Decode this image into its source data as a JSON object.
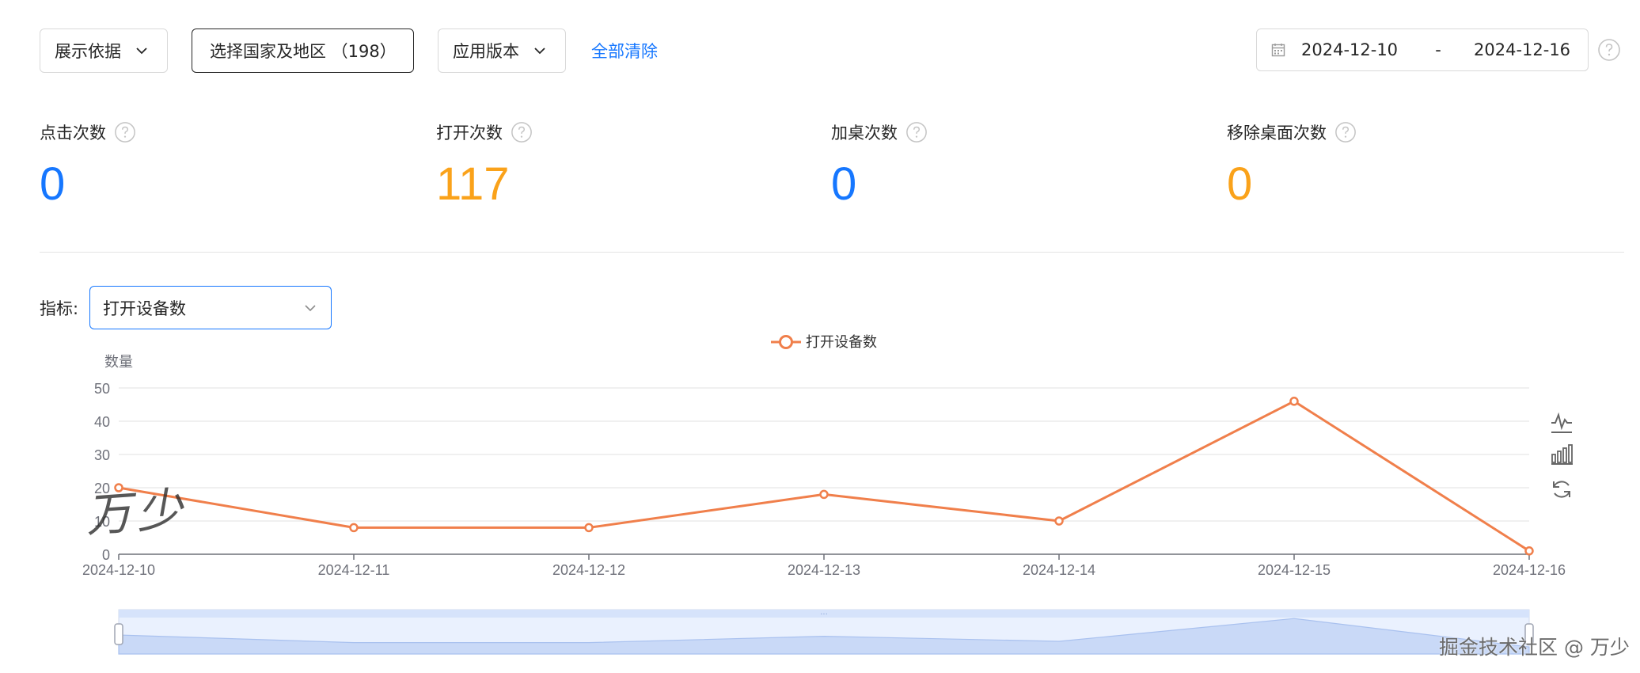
{
  "filters": {
    "basis_label": "展示依据",
    "country_label": "选择国家及地区 （198）",
    "version_label": "应用版本",
    "clear_label": "全部清除"
  },
  "date_range": {
    "start": "2024-12-10",
    "separator": "-",
    "end": "2024-12-16"
  },
  "metrics": [
    {
      "label": "点击次数",
      "value": "0",
      "color": "#1677ff"
    },
    {
      "label": "打开次数",
      "value": "117",
      "color": "#faa21a"
    },
    {
      "label": "加桌次数",
      "value": "0",
      "color": "#1677ff"
    },
    {
      "label": "移除桌面次数",
      "value": "0",
      "color": "#faa21a"
    }
  ],
  "indicator": {
    "label": "指标:",
    "selected": "打开设备数"
  },
  "colors": {
    "accent": "#1677ff",
    "series": "#f07f4b",
    "orange": "#faa21a"
  },
  "toolbox_icons": [
    "line-chart-icon",
    "bar-chart-icon",
    "restore-icon"
  ],
  "chart_data": {
    "type": "line",
    "ylabel": "数量",
    "x": [
      "2024-12-10",
      "2024-12-11",
      "2024-12-12",
      "2024-12-13",
      "2024-12-14",
      "2024-12-15",
      "2024-12-16"
    ],
    "series": [
      {
        "name": "打开设备数",
        "values": [
          20,
          8,
          8,
          18,
          10,
          46,
          1
        ]
      }
    ],
    "ylim": [
      0,
      50
    ],
    "yticks": [
      0,
      10,
      20,
      30,
      40,
      50
    ],
    "grid": true,
    "legend_position": "top-center",
    "datazoom": true
  },
  "watermarks": {
    "handwritten": "万少",
    "site": "掘金技术社区 @ 万少"
  }
}
